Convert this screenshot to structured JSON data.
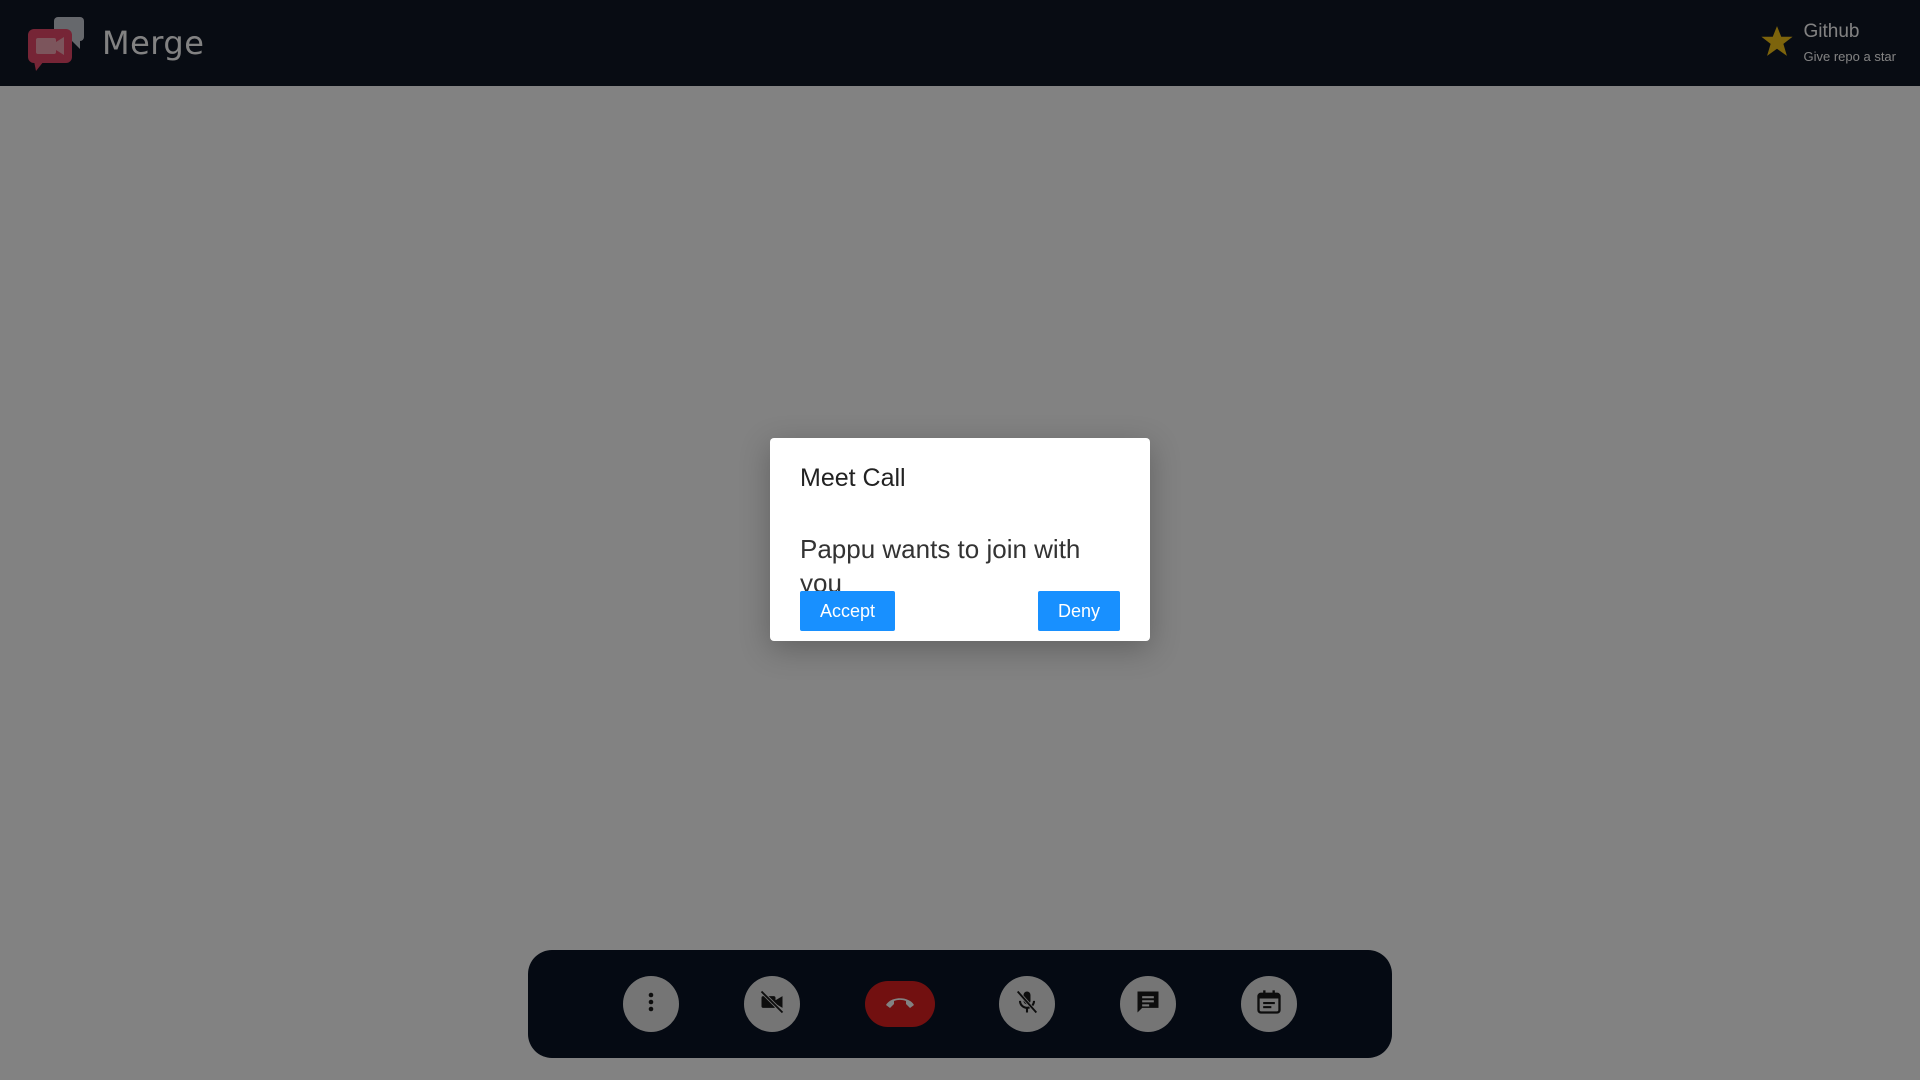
{
  "app": {
    "name": "Merge",
    "brand_color": "#e84a6a"
  },
  "github": {
    "title": "Github",
    "subtitle": "Give repo a star",
    "icon": "star-icon",
    "icon_color": "#d4a017"
  },
  "dialog": {
    "title": "Meet Call",
    "message": "Pappu wants to join with you",
    "accept_label": "Accept",
    "deny_label": "Deny",
    "button_color": "#1890ff"
  },
  "controls": {
    "items": [
      {
        "name": "more-options",
        "icon": "more-vertical-icon"
      },
      {
        "name": "toggle-video",
        "icon": "video-off-icon"
      },
      {
        "name": "end-call",
        "icon": "phone-hangup-icon",
        "color": "#e02020"
      },
      {
        "name": "toggle-mic",
        "icon": "mic-off-icon"
      },
      {
        "name": "chat",
        "icon": "chat-icon"
      },
      {
        "name": "schedule",
        "icon": "calendar-icon"
      }
    ]
  }
}
